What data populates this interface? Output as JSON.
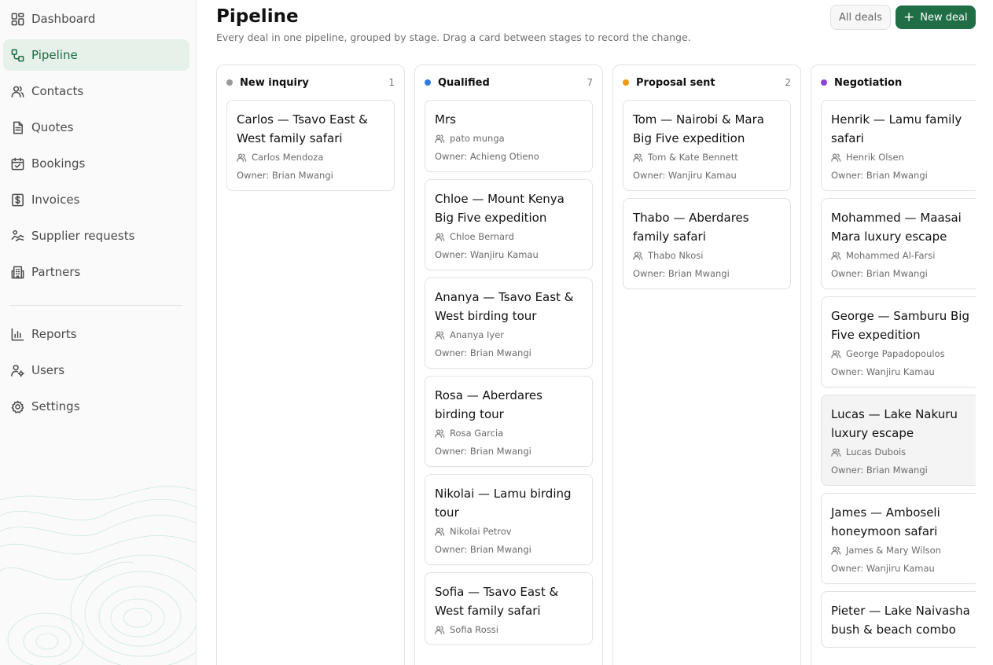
{
  "sidebar": {
    "items": [
      {
        "label": "Dashboard",
        "icon": "dashboard-icon"
      },
      {
        "label": "Pipeline",
        "icon": "pipeline-icon"
      },
      {
        "label": "Contacts",
        "icon": "contacts-icon"
      },
      {
        "label": "Quotes",
        "icon": "document-icon"
      },
      {
        "label": "Bookings",
        "icon": "calendar-check-icon"
      },
      {
        "label": "Invoices",
        "icon": "dollar-icon"
      },
      {
        "label": "Supplier requests",
        "icon": "handshake-icon"
      },
      {
        "label": "Partners",
        "icon": "building-icon"
      },
      {
        "label": "Reports",
        "icon": "bar-chart-icon"
      },
      {
        "label": "Users",
        "icon": "user-cog-icon"
      },
      {
        "label": "Settings",
        "icon": "gear-icon"
      }
    ],
    "active": "Pipeline"
  },
  "header": {
    "title": "Pipeline",
    "subtitle": "Every deal in one pipeline, grouped by stage. Drag a card between stages to record the change.",
    "all_deals_label": "All deals",
    "new_deal_label": "New deal"
  },
  "colors": {
    "accent": "#1f6e45",
    "new_inquiry": "#9a9a9a",
    "qualified": "#2f7be0",
    "proposal_sent": "#f29a12",
    "negotiation": "#8e44d6"
  },
  "columns": [
    {
      "title": "New inquiry",
      "count": "1",
      "cards": [
        {
          "title": "Carlos — Tsavo East & West family safari",
          "contact": "Carlos Mendoza",
          "owner": "Owner: Brian Mwangi"
        }
      ]
    },
    {
      "title": "Qualified",
      "count": "7",
      "cards": [
        {
          "title": "Mrs",
          "contact": "pato munga",
          "owner": "Owner: Achieng Otieno"
        },
        {
          "title": "Chloe — Mount Kenya Big Five expedition",
          "contact": "Chloe Bernard",
          "owner": "Owner: Wanjiru Kamau"
        },
        {
          "title": "Ananya — Tsavo East & West birding tour",
          "contact": "Ananya Iyer",
          "owner": "Owner: Brian Mwangi"
        },
        {
          "title": "Rosa — Aberdares birding tour",
          "contact": "Rosa Garcia",
          "owner": "Owner: Brian Mwangi"
        },
        {
          "title": "Nikolai — Lamu birding tour",
          "contact": "Nikolai Petrov",
          "owner": "Owner: Brian Mwangi"
        },
        {
          "title": "Sofia — Tsavo East & West family safari",
          "contact": "Sofia Rossi",
          "owner": ""
        }
      ]
    },
    {
      "title": "Proposal sent",
      "count": "2",
      "cards": [
        {
          "title": "Tom — Nairobi & Mara Big Five expedition",
          "contact": "Tom & Kate Bennett",
          "owner": "Owner: Wanjiru Kamau"
        },
        {
          "title": "Thabo — Aberdares family safari",
          "contact": "Thabo Nkosi",
          "owner": "Owner: Brian Mwangi"
        }
      ]
    },
    {
      "title": "Negotiation",
      "count": "",
      "cards": [
        {
          "title": "Henrik — Lamu family safari",
          "contact": "Henrik Olsen",
          "owner": "Owner: Brian Mwangi"
        },
        {
          "title": "Mohammed — Maasai Mara luxury escape",
          "contact": "Mohammed Al-Farsi",
          "owner": "Owner: Brian Mwangi"
        },
        {
          "title": "George — Samburu Big Five expedition",
          "contact": "George Papadopoulos",
          "owner": "Owner: Wanjiru Kamau"
        },
        {
          "title": "Lucas — Lake Nakuru luxury escape",
          "contact": "Lucas Dubois",
          "owner": "Owner: Brian Mwangi"
        },
        {
          "title": "James — Amboseli honeymoon safari",
          "contact": "James & Mary Wilson",
          "owner": "Owner: Wanjiru Kamau"
        },
        {
          "title": "Pieter — Lake Naivasha bush & beach combo",
          "contact": "",
          "owner": ""
        }
      ]
    }
  ]
}
